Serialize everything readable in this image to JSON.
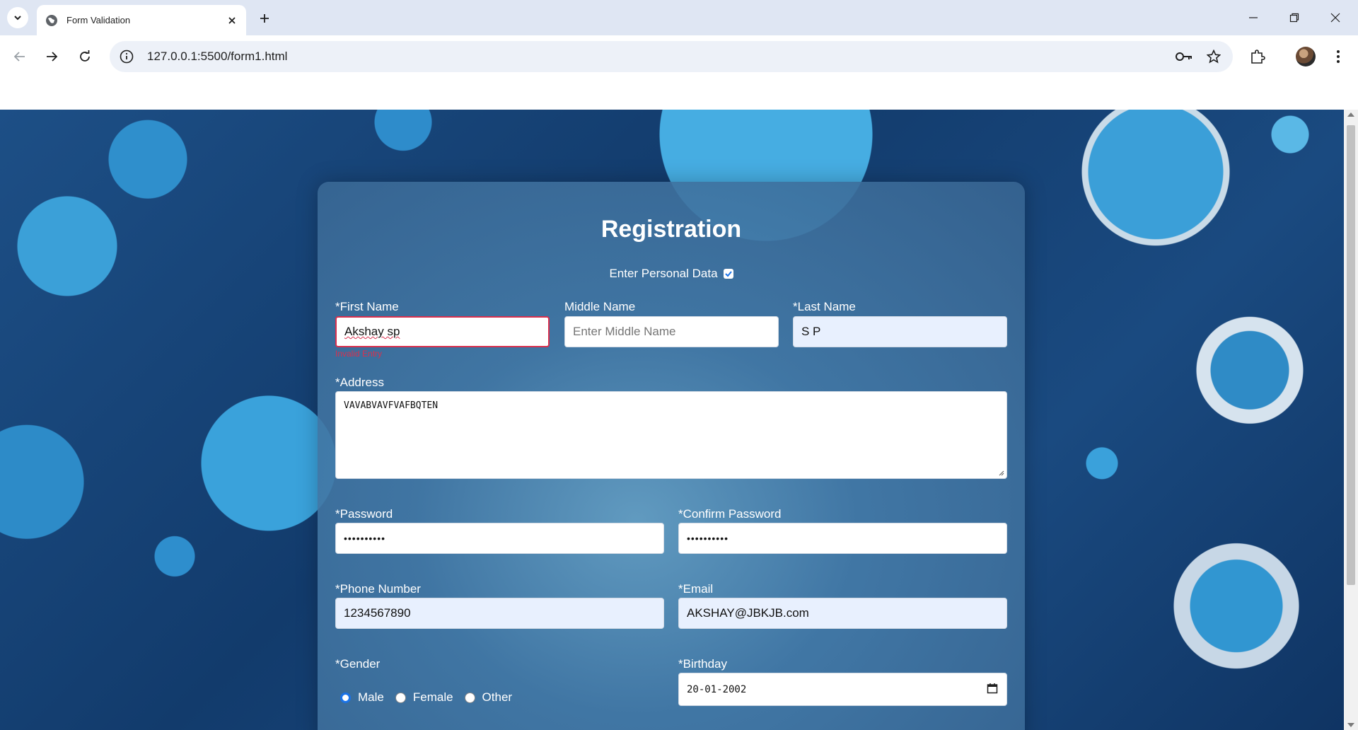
{
  "browser": {
    "tab_title": "Form Validation",
    "url": "127.0.0.1:5500/form1.html"
  },
  "form": {
    "heading": "Registration",
    "personal_data_label": "Enter Personal Data",
    "personal_data_checked": true,
    "first_name": {
      "label": "*First Name",
      "value": "Akshay  sp",
      "error": "Invalid Entry"
    },
    "middle_name": {
      "label": "Middle Name",
      "placeholder": "Enter Middle Name"
    },
    "last_name": {
      "label": "*Last Name",
      "value": "S P"
    },
    "address": {
      "label": "*Address",
      "value": "VAVABVAVFVAFBQTEN"
    },
    "password": {
      "label": "*Password",
      "value": "••••••••••"
    },
    "confirm_password": {
      "label": "*Confirm Password",
      "value": "••••••••••"
    },
    "phone": {
      "label": "*Phone Number",
      "value": "1234567890"
    },
    "email": {
      "label": "*Email",
      "value": "AKSHAY@JBKJB.com"
    },
    "gender": {
      "label": "*Gender",
      "options": [
        "Male",
        "Female",
        "Other"
      ],
      "selected": "Male"
    },
    "birthday": {
      "label": "*Birthday",
      "value": "20-01-2002"
    }
  },
  "colors": {
    "error": "#d9304e",
    "accent": "#1a73e8",
    "autofill": "#e8f0fe"
  },
  "icons": [
    "chevron-down-icon",
    "globe-icon",
    "close-icon",
    "plus-icon",
    "minimize-icon",
    "restore-icon",
    "back-icon",
    "forward-icon",
    "reload-icon",
    "info-icon",
    "key-icon",
    "star-icon",
    "extensions-icon",
    "kebab-menu-icon",
    "calendar-icon"
  ]
}
